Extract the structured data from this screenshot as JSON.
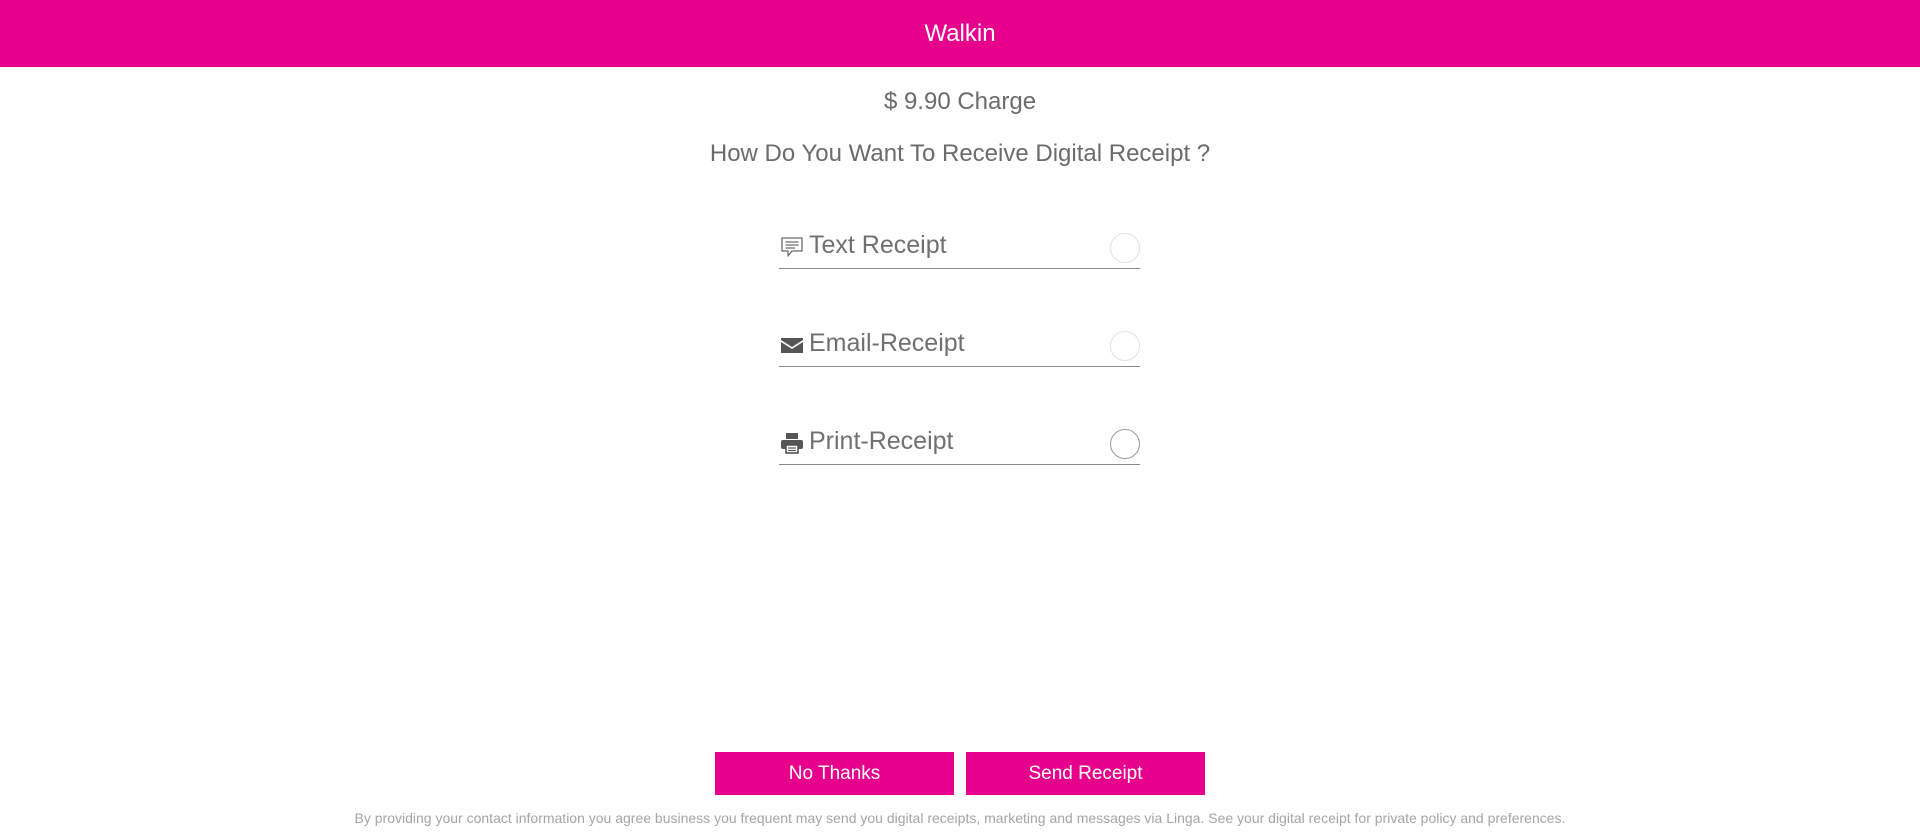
{
  "header": {
    "title": "Walkin",
    "color": "#e6008c"
  },
  "charge": {
    "text": "$ 9.90 Charge"
  },
  "question": {
    "text": "How Do You Want To Receive Digital Receipt ?"
  },
  "options": [
    {
      "label": "Text Receipt",
      "icon": "chat-bubble-icon",
      "selected": false
    },
    {
      "label": "Email-Receipt",
      "icon": "envelope-icon",
      "selected": false
    },
    {
      "label": "Print-Receipt",
      "icon": "printer-icon",
      "selected": false
    }
  ],
  "buttons": {
    "no_thanks": "No Thanks",
    "send_receipt": "Send Receipt"
  },
  "disclaimer": {
    "text": "By providing your contact information you agree business you frequent may send you digital receipts, marketing and messages via Linga. See your digital receipt for private policy and preferences."
  }
}
